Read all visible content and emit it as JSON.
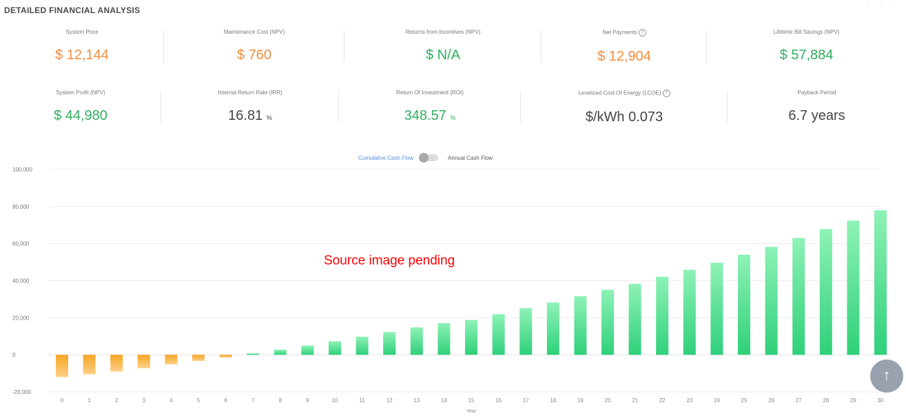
{
  "header": {
    "title": "DETAILED FINANCIAL ANALYSIS"
  },
  "metrics_row1": [
    {
      "label": "System Price",
      "value": "$ 12,144",
      "unit": "",
      "color": "#f28b3b",
      "help": false
    },
    {
      "label": "Maintenance Cost (NPV)",
      "value": "$ 760",
      "unit": "",
      "color": "#f28b3b",
      "help": false
    },
    {
      "label": "Returns from Incentives (NPV)",
      "value": "$ N/A",
      "unit": "",
      "color": "#2fae5e",
      "help": false
    },
    {
      "label": "Net Payments",
      "value": "$ 12,904",
      "unit": "",
      "color": "#f28b3b",
      "help": true
    },
    {
      "label": "Lifetime Bill Savings (NPV)",
      "value": "$ 57,884",
      "unit": "",
      "color": "#2fae5e",
      "help": false
    }
  ],
  "metrics_row2": [
    {
      "label": "System Profit (NPV)",
      "value": "$ 44,980",
      "unit": "",
      "color": "#2fae5e",
      "help": false
    },
    {
      "label": "Internal Return Rate (IRR)",
      "value": "16.81",
      "unit": "%",
      "color": "#444444",
      "help": false
    },
    {
      "label": "Return Of Investment (ROI)",
      "value": "348.57",
      "unit": "%",
      "color": "#2fae5e",
      "help": false
    },
    {
      "label": "Levelized Cost Of Energy (LCOE)",
      "value": "$/kWh 0.073",
      "unit": "",
      "color": "#444444",
      "help": true
    },
    {
      "label": "Payback Period",
      "value": "6.7 years",
      "unit": "",
      "color": "#444444",
      "help": false
    }
  ],
  "toggle": {
    "left_label": "Cumulative Cash Flow",
    "right_label": "Annual Cash Flow"
  },
  "overlay": {
    "message": "Source image pending"
  },
  "chart_data": {
    "type": "bar",
    "title": "",
    "xlabel": "Year",
    "ylabel": "",
    "ylim": [
      -20000,
      100000
    ],
    "yticks": [
      -20000,
      0,
      20000,
      40000,
      60000,
      80000,
      100000
    ],
    "ytick_labels": [
      "-20,000",
      "0",
      "20,000",
      "40,000",
      "60,000",
      "80,000",
      "100,000"
    ],
    "categories": [
      "0",
      "1",
      "2",
      "3",
      "4",
      "5",
      "6",
      "7",
      "8",
      "9",
      "10",
      "11",
      "12",
      "13",
      "14",
      "15",
      "16",
      "17",
      "18",
      "19",
      "20",
      "21",
      "22",
      "23",
      "24",
      "25",
      "26",
      "27",
      "28",
      "29",
      "30"
    ],
    "values": [
      -12000,
      -10500,
      -9000,
      -7200,
      -5200,
      -3300,
      -1500,
      800,
      2800,
      5000,
      7300,
      9800,
      12300,
      14800,
      17100,
      18800,
      21900,
      25200,
      28200,
      31600,
      35100,
      38300,
      42100,
      45900,
      49700,
      54000,
      58200,
      63000,
      67800,
      72400,
      78000
    ],
    "negative_color": "#f5a623",
    "positive_color": "#2fd07a",
    "grid": true
  }
}
